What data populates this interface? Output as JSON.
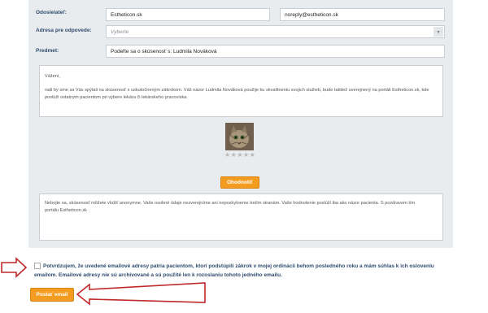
{
  "form": {
    "sender_label": "Odosielateľ:",
    "sender_name": "Estheticon.sk",
    "sender_email": "noreply@estheticon.sk",
    "reply_label": "Adresa pre odpovede:",
    "reply_placeholder": "Vyberte",
    "subject_label": "Predmet:",
    "subject_value": "Podeľte sa o skúsenosť s: Ludmila Nováková"
  },
  "message": {
    "greeting": "Vážení,",
    "body": "radi by sme sa Vás spýtali na skúsenosť s uskutočneným zákrokom. Váš názor Ludmila Nováková použije ku skvalitneniu svojich služieb, bude taktiež uverejnený na portáli Estheticon.sk, kde poslúži ostatným pacientom pri výbere lekára či lekárskeho pracoviska.",
    "stars": "★★★★★",
    "rate_button": "Ohodnotiť",
    "footer": "Nebojte sa, skúsenosť môžete vložiť anonymne. Vaše osobné údaje nezverejníme ani neposkytneme tretím stranám. Vaše hodnotenie poslúži iba ako názor pacienta. S pozdravom tím portálu Estheticon.sk"
  },
  "consent": {
    "text": "Potvrdzujem, že uvedené emailové adresy patria pacientom, ktorí podstúpili zákrok v mojej ordinácii behom posledného roku a mám súhlas k ich osloveniu emailom. Emailové adresy nie sú archivované a sú použité len k rozoslaniu tohoto jedného emailu."
  },
  "submit_label": "Poslať email",
  "colors": {
    "accent": "#f39c1f",
    "label": "#2f4b6e",
    "arrow": "#c0282a"
  }
}
